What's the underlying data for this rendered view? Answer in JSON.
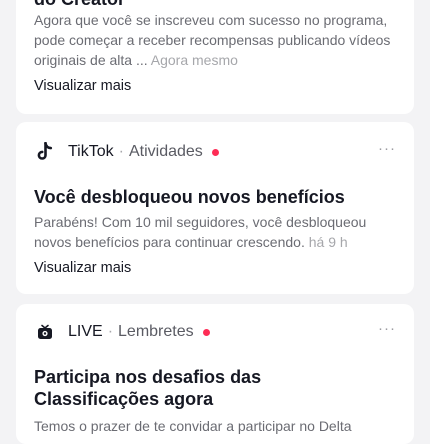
{
  "colors": {
    "unread_dot": "#fe2c55",
    "background": "#f3f3f5",
    "card": "#ffffff"
  },
  "cards": [
    {
      "title_fragment": "do Creator",
      "body": "Agora que você se inscreveu com sucesso no programa, pode começar a receber recompensas publicando vídeos originais de alta ...",
      "time": "Agora mesmo",
      "link": "Visualizar mais"
    },
    {
      "icon": "tiktok-logo-icon",
      "source": "TikTok",
      "category": "Atividades",
      "title": "Você desbloqueou novos benefícios",
      "body": "Parabéns! Com 10 mil seguidores, você desbloqueou novos benefícios para continuar crescendo.",
      "time": "há 9 h",
      "link": "Visualizar mais"
    },
    {
      "icon": "live-icon",
      "source": "LIVE",
      "category": "Lembretes",
      "title": "Participa nos desafios das Classificações agora",
      "body": "Temos o prazer de te convidar a participar no Delta"
    }
  ],
  "more_label": "···"
}
